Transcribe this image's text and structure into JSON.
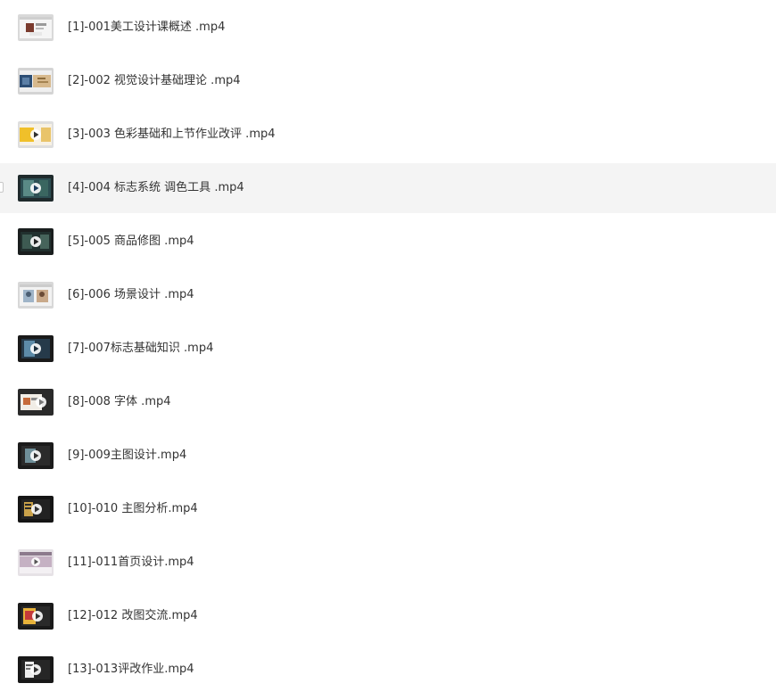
{
  "file_list": {
    "hovered_index": 3,
    "items": [
      {
        "name": "[1]-001美工设计课概述 .mp4",
        "thumb_icon": "video-thumbnail-icon",
        "thumb_style": "light"
      },
      {
        "name": "[2]-002 视觉设计基础理论 .mp4",
        "thumb_icon": "video-thumbnail-icon",
        "thumb_style": "light-blue"
      },
      {
        "name": "[3]-003 色彩基础和上节作业改评 .mp4",
        "thumb_icon": "video-thumbnail-icon",
        "thumb_style": "yellow"
      },
      {
        "name": "[4]-004 标志系统 调色工具 .mp4",
        "thumb_icon": "video-thumbnail-icon",
        "thumb_style": "dark-teal"
      },
      {
        "name": "[5]-005 商品修图 .mp4",
        "thumb_icon": "video-thumbnail-icon",
        "thumb_style": "dark-green"
      },
      {
        "name": "[6]-006 场景设计 .mp4",
        "thumb_icon": "video-thumbnail-icon",
        "thumb_style": "light-photo"
      },
      {
        "name": "[7]-007标志基础知识 .mp4",
        "thumb_icon": "video-thumbnail-icon",
        "thumb_style": "dark-blue"
      },
      {
        "name": "[8]-008 字体 .mp4",
        "thumb_icon": "video-thumbnail-icon",
        "thumb_style": "dark-light"
      },
      {
        "name": "[9]-009主图设计.mp4",
        "thumb_icon": "video-thumbnail-icon",
        "thumb_style": "dark-gray"
      },
      {
        "name": "[10]-010 主图分析.mp4",
        "thumb_icon": "video-thumbnail-icon",
        "thumb_style": "dark-gold"
      },
      {
        "name": "[11]-011首页设计.mp4",
        "thumb_icon": "video-thumbnail-icon",
        "thumb_style": "mauve"
      },
      {
        "name": "[12]-012 改图交流.mp4",
        "thumb_icon": "video-thumbnail-icon",
        "thumb_style": "dark-red"
      },
      {
        "name": "[13]-013评改作业.mp4",
        "thumb_icon": "video-thumbnail-icon",
        "thumb_style": "dark-white"
      }
    ]
  }
}
